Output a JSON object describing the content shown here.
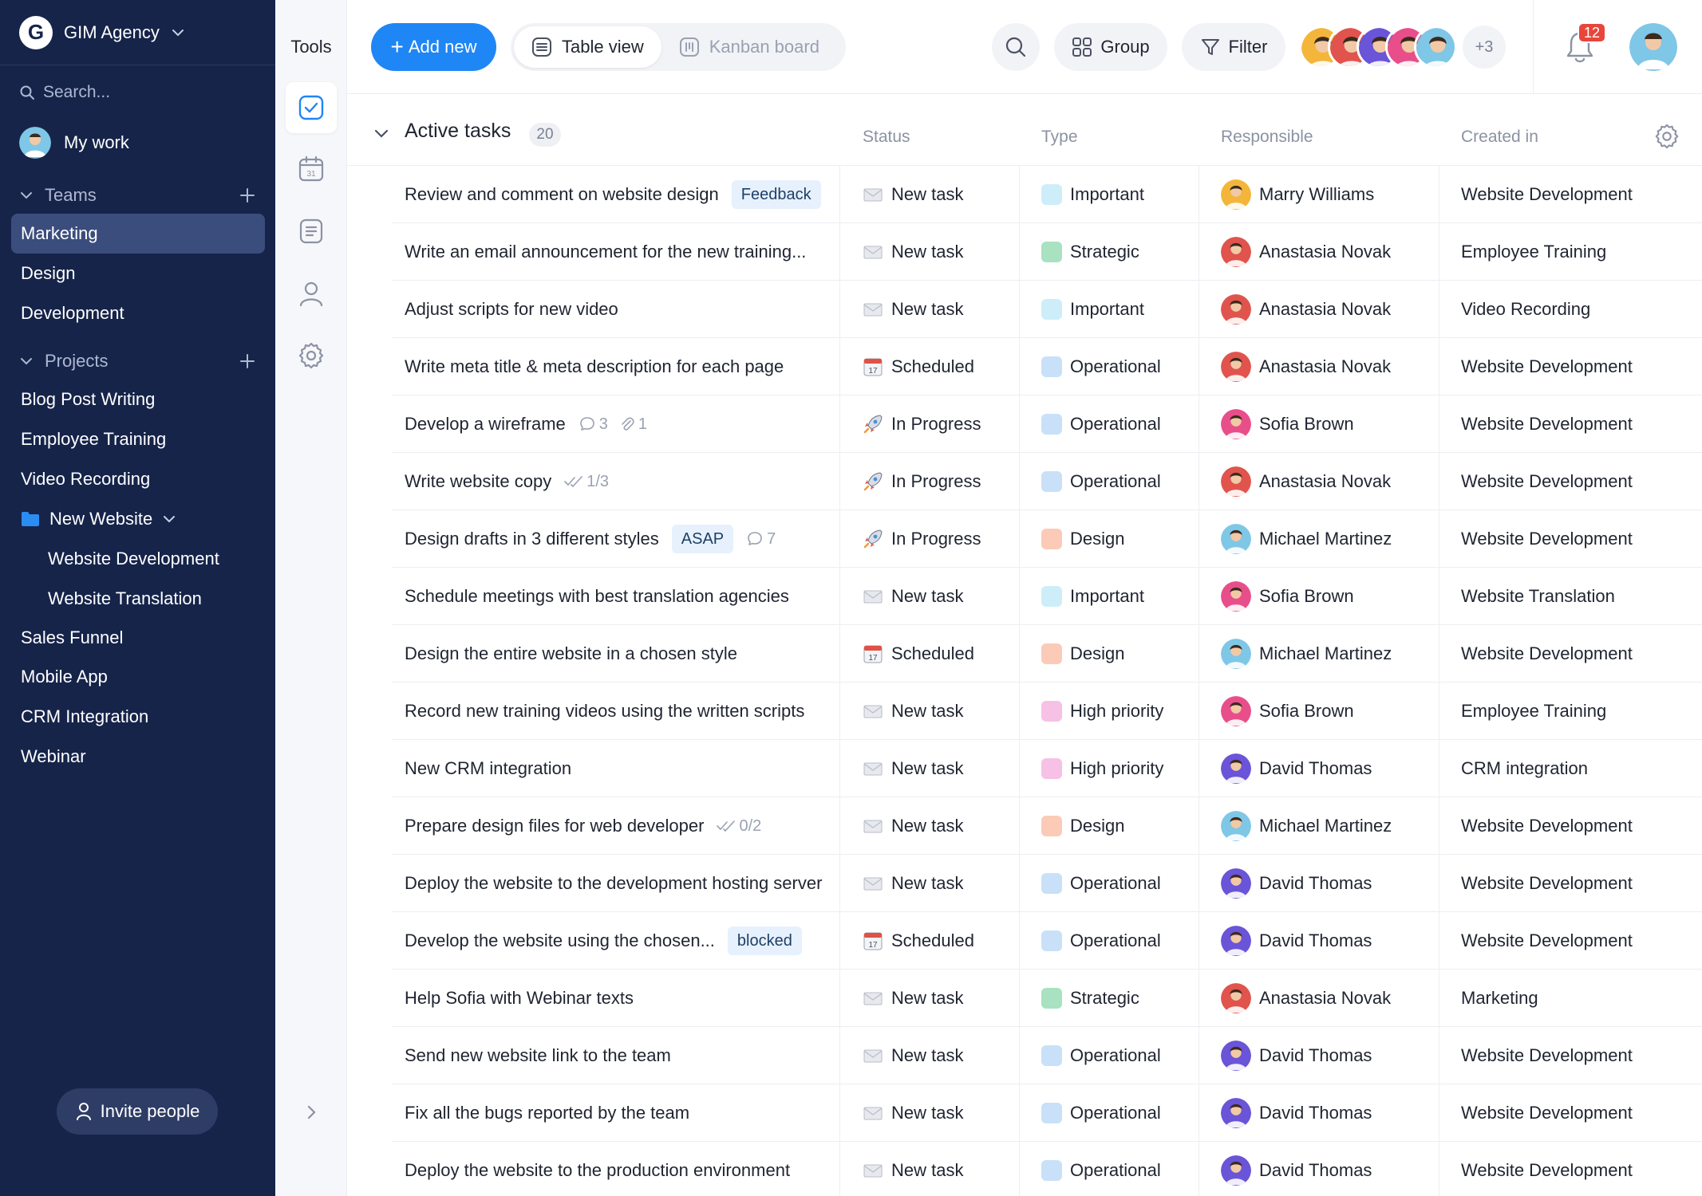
{
  "workspace": {
    "logo_letter": "G",
    "name": "GIM Agency"
  },
  "sidebar": {
    "search_placeholder": "Search...",
    "my_work": "My work",
    "teams_label": "Teams",
    "teams": [
      "Marketing",
      "Design",
      "Development"
    ],
    "projects_label": "Projects",
    "projects": [
      "Blog Post Writing",
      "Employee Training",
      "Video Recording"
    ],
    "folder": {
      "label": "New Website",
      "children": [
        "Website Development",
        "Website Translation"
      ]
    },
    "projects_after": [
      "Sales Funnel",
      "Mobile App",
      "CRM Integration",
      "Webinar"
    ],
    "invite_label": "Invite people"
  },
  "tools": {
    "title": "Tools"
  },
  "topbar": {
    "add_label": "Add new",
    "table_view": "Table view",
    "kanban_board": "Kanban board",
    "group_label": "Group",
    "filter_label": "Filter",
    "more_members": "+3",
    "notification_count": "12"
  },
  "table": {
    "group_title": "Active tasks",
    "group_count": "20",
    "columns": {
      "status": "Status",
      "type": "Type",
      "responsible": "Responsible",
      "created_in": "Created in"
    },
    "rows": [
      {
        "task": "Review and comment on website design",
        "tag": "Feedback",
        "status": "New task",
        "status_icon": "envelope",
        "type": "Important",
        "type_color": "#cdeef9",
        "person": "Marry Williams",
        "avatar_color": "#f3b63a",
        "project": "Website Development"
      },
      {
        "task": "Write an email announcement for the new training...",
        "status": "New task",
        "status_icon": "envelope",
        "type": "Strategic",
        "type_color": "#a8e2c0",
        "person": "Anastasia Novak",
        "avatar_color": "#e0544d",
        "project": "Employee Training"
      },
      {
        "task": "Adjust scripts for new video",
        "status": "New task",
        "status_icon": "envelope",
        "type": "Important",
        "type_color": "#cdeef9",
        "person": "Anastasia Novak",
        "avatar_color": "#e0544d",
        "project": "Video Recording"
      },
      {
        "task": "Write meta title & meta description for each page",
        "status": "Scheduled",
        "status_icon": "calendar",
        "type": "Operational",
        "type_color": "#c8e1f8",
        "person": "Anastasia Novak",
        "avatar_color": "#e0544d",
        "project": "Website Development"
      },
      {
        "task": "Develop a wireframe",
        "comments": "3",
        "attachments": "1",
        "status": "In Progress",
        "status_icon": "rocket",
        "type": "Operational",
        "type_color": "#c8e1f8",
        "person": "Sofia Brown",
        "avatar_color": "#e84f8a",
        "project": "Website Development"
      },
      {
        "task": "Write website copy",
        "checklist": "1/3",
        "status": "In Progress",
        "status_icon": "rocket",
        "type": "Operational",
        "type_color": "#c8e1f8",
        "person": "Anastasia Novak",
        "avatar_color": "#e0544d",
        "project": "Website Development"
      },
      {
        "task": "Design drafts in 3 different styles",
        "tag": "ASAP",
        "comments": "7",
        "status": "In Progress",
        "status_icon": "rocket",
        "type": "Design",
        "type_color": "#fbcbb8",
        "person": "Michael Martinez",
        "avatar_color": "#7fc7e6",
        "project": "Website Development"
      },
      {
        "task": "Schedule meetings with best translation agencies",
        "status": "New task",
        "status_icon": "envelope",
        "type": "Important",
        "type_color": "#cdeef9",
        "person": "Sofia Brown",
        "avatar_color": "#e84f8a",
        "project": "Website Translation"
      },
      {
        "task": "Design the entire website in a chosen style",
        "status": "Scheduled",
        "status_icon": "calendar",
        "type": "Design",
        "type_color": "#fbcbb8",
        "person": "Michael Martinez",
        "avatar_color": "#7fc7e6",
        "project": "Website Development"
      },
      {
        "task": "Record new training videos using the written scripts",
        "status": "New task",
        "status_icon": "envelope",
        "type": "High priority",
        "type_color": "#f6c1e4",
        "person": "Sofia Brown",
        "avatar_color": "#e84f8a",
        "project": "Employee Training"
      },
      {
        "task": "New CRM integration",
        "status": "New task",
        "status_icon": "envelope",
        "type": "High priority",
        "type_color": "#f6c1e4",
        "person": "David Thomas",
        "avatar_color": "#6a54d8",
        "project": "CRM integration"
      },
      {
        "task": "Prepare design files for web developer",
        "checklist": "0/2",
        "status": "New task",
        "status_icon": "envelope",
        "type": "Design",
        "type_color": "#fbcbb8",
        "person": "Michael Martinez",
        "avatar_color": "#7fc7e6",
        "project": "Website Development"
      },
      {
        "task": "Deploy the website to the development hosting server",
        "status": "New task",
        "status_icon": "envelope",
        "type": "Operational",
        "type_color": "#c8e1f8",
        "person": "David Thomas",
        "avatar_color": "#6a54d8",
        "project": "Website Development"
      },
      {
        "task": "Develop the website using the chosen...",
        "tag": "blocked",
        "status": "Scheduled",
        "status_icon": "calendar",
        "type": "Operational",
        "type_color": "#c8e1f8",
        "person": "David Thomas",
        "avatar_color": "#6a54d8",
        "project": "Website Development"
      },
      {
        "task": "Help Sofia with Webinar texts",
        "status": "New task",
        "status_icon": "envelope",
        "type": "Strategic",
        "type_color": "#a8e2c0",
        "person": "Anastasia Novak",
        "avatar_color": "#e0544d",
        "project": "Marketing"
      },
      {
        "task": "Send new website link to the team",
        "status": "New task",
        "status_icon": "envelope",
        "type": "Operational",
        "type_color": "#c8e1f8",
        "person": "David Thomas",
        "avatar_color": "#6a54d8",
        "project": "Website Development"
      },
      {
        "task": "Fix all the bugs reported by the team",
        "status": "New task",
        "status_icon": "envelope",
        "type": "Operational",
        "type_color": "#c8e1f8",
        "person": "David Thomas",
        "avatar_color": "#6a54d8",
        "project": "Website Development"
      },
      {
        "task": "Deploy the website to the production environment",
        "status": "New task",
        "status_icon": "envelope",
        "type": "Operational",
        "type_color": "#c8e1f8",
        "person": "David Thomas",
        "avatar_color": "#6a54d8",
        "project": "Website Development"
      }
    ]
  },
  "colors": {
    "sidebar_bg": "#16244a",
    "accent": "#1f86f5",
    "active_nav": "#3b4d7c",
    "badge": "#e8463b"
  },
  "member_avatars": [
    "#f3b63a",
    "#e0544d",
    "#6a54d8",
    "#e84f8a",
    "#7fc7e6"
  ]
}
